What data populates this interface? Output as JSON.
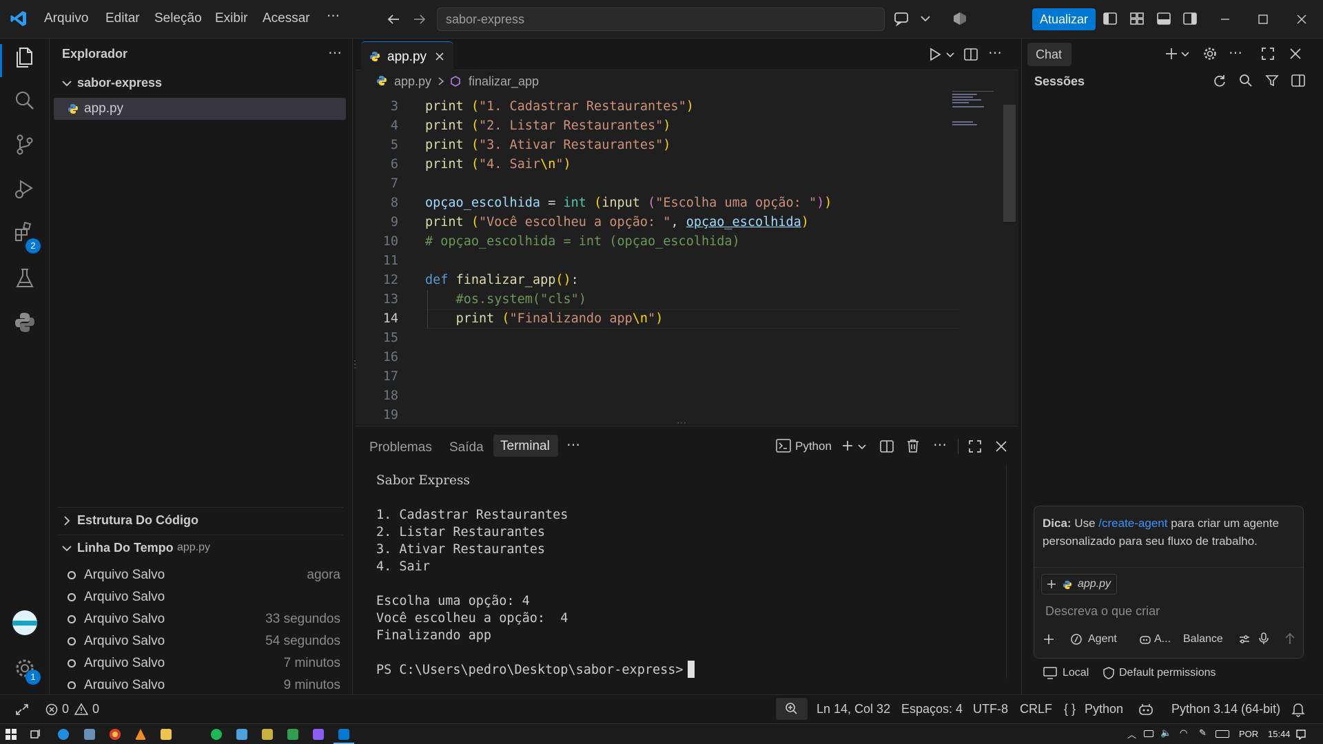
{
  "menu": [
    "Arquivo",
    "Editar",
    "Seleção",
    "Exibir",
    "Acessar"
  ],
  "command_center": "sabor-express",
  "update_button": "Atualizar",
  "activity": {
    "extensions_badge": "2",
    "settings_badge": "1"
  },
  "explorer": {
    "title": "Explorador",
    "folder": "sabor-express",
    "file": "app.py",
    "outline": "Estrutura Do Código",
    "timeline": "Linha Do Tempo",
    "timeline_file": "app.py",
    "timeline_items": [
      {
        "label": "Arquivo Salvo",
        "time": "agora"
      },
      {
        "label": "Arquivo Salvo",
        "time": ""
      },
      {
        "label": "Arquivo Salvo",
        "time": "33 segundos"
      },
      {
        "label": "Arquivo Salvo",
        "time": "54 segundos"
      },
      {
        "label": "Arquivo Salvo",
        "time": "7 minutos"
      },
      {
        "label": "Arquivo Salvo",
        "time": "9 minutos"
      }
    ]
  },
  "editor": {
    "tab": "app.py",
    "breadcrumb_file": "app.py",
    "breadcrumb_symbol": "finalizar_app",
    "line_numbers": [
      "3",
      "4",
      "5",
      "6",
      "7",
      "8",
      "9",
      "10",
      "11",
      "12",
      "13",
      "14",
      "15",
      "16",
      "17",
      "18",
      "19"
    ],
    "current_line": "14"
  },
  "panel": {
    "tabs": [
      "Problemas",
      "Saída",
      "Terminal"
    ],
    "active_tab": "Terminal",
    "shell": "Python",
    "terminal": [
      "Sabor Express",
      "",
      "1. Cadastrar Restaurantes",
      "2. Listar Restaurantes",
      "3. Ativar Restaurantes",
      "4. Sair",
      "",
      "Escolha uma opção: 4",
      "Você escolheu a opção:  4",
      "Finalizando app",
      "",
      "PS C:\\Users\\pedro\\Desktop\\sabor-express> "
    ]
  },
  "chat": {
    "tab": "Chat",
    "sessions": "Sessões",
    "tip_label": "Dica:",
    "tip_pre": "Use",
    "tip_link": "/create-agent",
    "tip_post": "para criar um agente personalizado para seu fluxo de trabalho.",
    "context_file": "app.py",
    "placeholder": "Descreva o que criar",
    "agent": "Agent",
    "model": "A...",
    "mode": "Balance",
    "local": "Local",
    "permissions": "Default permissions"
  },
  "status": {
    "errors": "0",
    "warnings": "0",
    "position": "Ln 14, Col 32",
    "spaces": "Espaços: 4",
    "encoding": "UTF-8",
    "eol": "CRLF",
    "language": "Python",
    "interpreter": "Python 3.14 (64-bit)"
  },
  "taskbar": {
    "lang": "POR",
    "time": "15:44"
  },
  "colors": {
    "accent": "#0078d4",
    "background": "#1f1f1f",
    "sidebar": "#181818"
  }
}
